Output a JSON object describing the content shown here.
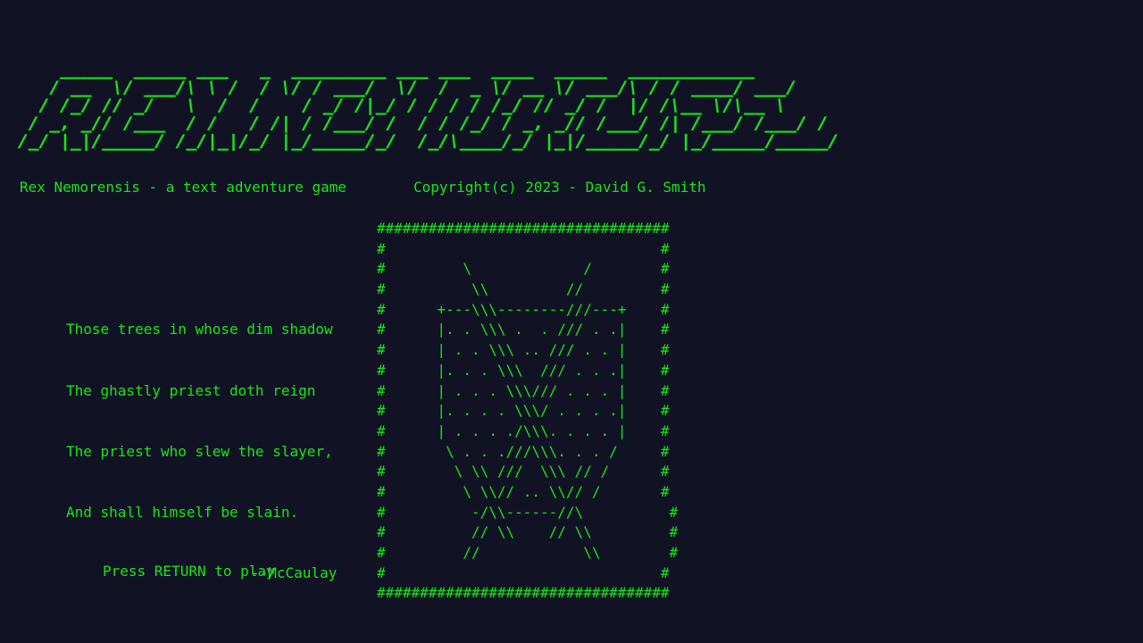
{
  "banner": {
    "title_art_lines": [
      "    _____  _____ ___   _  _________ ___ ___  ____  _____  ____________",
      "   / __  \\/ ___/\\ \\ /  / \\/ / ___/  \\/  /  _ \\/ __ \\/ ___/\\ / / ____/ ___/",
      "  / /_/ // _/   \\  /  /    / _/ /|_/ / / / / /_/ // _/ /  |/ /\\__ \\/\\__ \\",
      " / _, _// /___  / /   / /| / /___/ /  / / /_/ / _, _// /___/ /| /___/ /___/ /",
      "/_/ |_|/_____/ /_/|_|/_/ |_/_____/_/  /_/\\____/_/ |_|/_____/_/ |_/_____/_____/"
    ]
  },
  "subtitle": {
    "left": "Rex Nemorensis - a text adventure game",
    "right": "Copyright(c) 2023 - David G. Smith"
  },
  "poem": {
    "lines": [
      "Those trees in whose dim shadow",
      "The ghastly priest doth reign",
      "The priest who slew the slayer,",
      "And shall himself be slain."
    ],
    "attribution": "--McCaulay"
  },
  "prompt": {
    "press_return": "Press RETURN to play"
  },
  "art": {
    "lines": [
      "##################################",
      "#                                #",
      "#         \\             /        #",
      "#          \\\\         //         #",
      "#      +---\\\\\\--------///---+    #",
      "#      |. . \\\\\\ .  . /// . .|    #",
      "#      | . . \\\\\\ .. /// . . |    #",
      "#      |. . . \\\\\\  /// . . .|    #",
      "#      | . . . \\\\\\/// . . . |    #",
      "#      |. . . . \\\\\\/ . . . .|    #",
      "#      | . . . ./\\\\\\. . . . |    #",
      "#       \\ . . .///\\\\\\. . . /     #",
      "#        \\ \\\\ ///  \\\\\\ // /      #",
      "#         \\ \\\\// .. \\\\// /       #",
      "#          -/\\\\------//\\          #",
      "#          // \\\\    // \\\\         #",
      "#         //            \\\\        #",
      "#                                #",
      "##################################"
    ]
  },
  "colors": {
    "background": "#111325",
    "text": "#19e619"
  }
}
